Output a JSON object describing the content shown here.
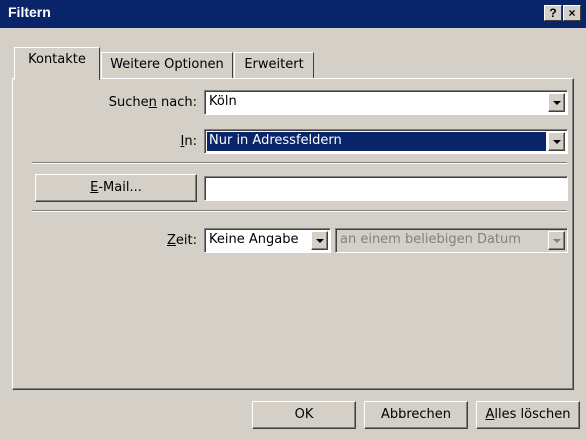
{
  "window": {
    "title": "Filtern",
    "help_label": "?",
    "close_label": "×"
  },
  "tabs": [
    {
      "label": "Kontakte",
      "active": true
    },
    {
      "label": "Weitere Optionen",
      "active": false
    },
    {
      "label": "Erweitert",
      "active": false
    }
  ],
  "search": {
    "label_pre": "Suche",
    "label_key": "n",
    "label_post": " nach:",
    "value": "Köln"
  },
  "in": {
    "label_key": "I",
    "label_post": "n:",
    "value": "Nur in Adressfeldern"
  },
  "email": {
    "button_key": "E",
    "button_post": "-Mail...",
    "value": ""
  },
  "time": {
    "label_key": "Z",
    "label_post": "eit:",
    "value": "Keine Angabe",
    "date_value": "an einem beliebigen Datum"
  },
  "buttons": {
    "ok": "OK",
    "cancel": "Abbrechen",
    "clear_key": "A",
    "clear_post": "lles löschen"
  }
}
